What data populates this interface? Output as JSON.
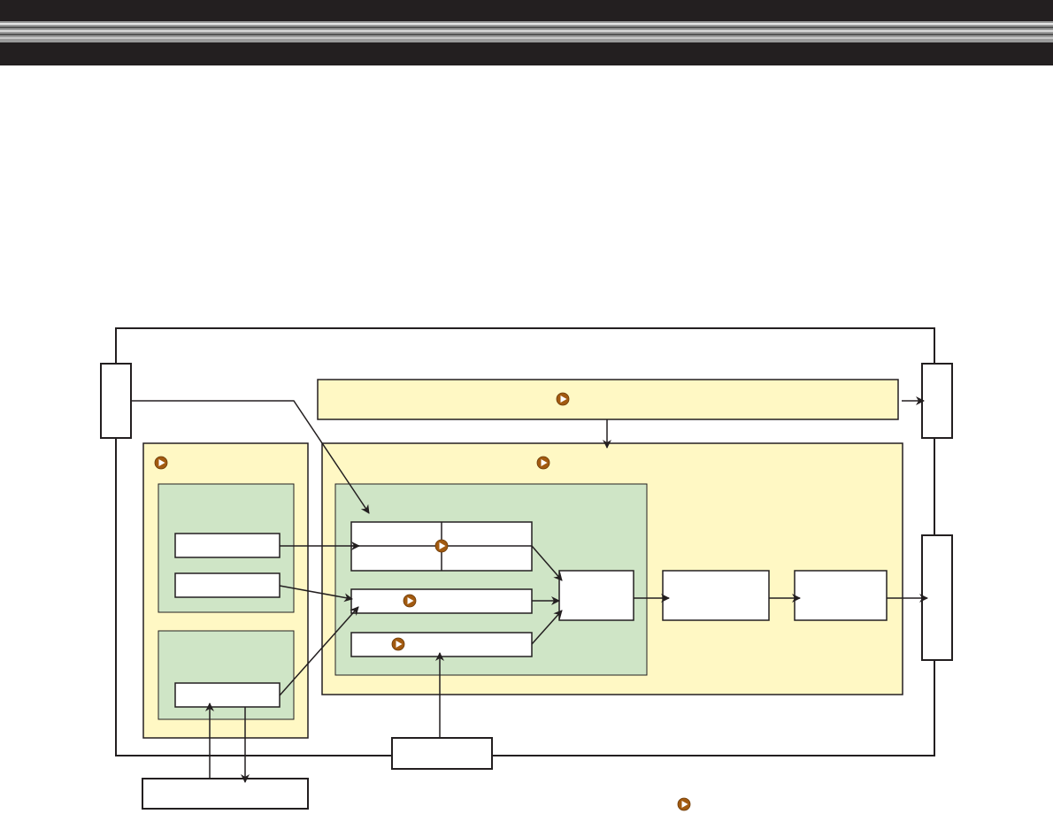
{
  "header": {
    "bar_color": "#231f20",
    "stripe_color": "#9a9a9a"
  },
  "colors": {
    "yellow_panel": "#fff8c4",
    "green_panel": "#cfe5c6",
    "stroke": "#231f20",
    "marker_fill": "#a25a10"
  },
  "icons": {
    "marker": "play-circle-icon"
  }
}
